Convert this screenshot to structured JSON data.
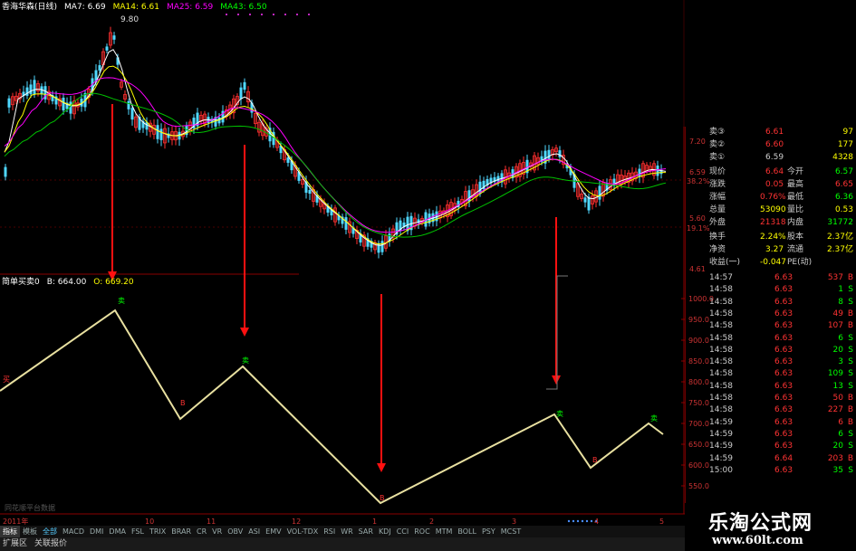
{
  "header": {
    "stock": "香海华森(日线)",
    "ma7": "MA7: 6.69",
    "ma14": "MA14: 6.61",
    "ma25": "MA25: 6.59",
    "ma43": "MA43: 6.50",
    "peak_label": "9.80",
    "colors": {
      "ma7": "#ffffff",
      "ma14": "#ffff00",
      "ma25": "#ff00ff",
      "ma43": "#00ff00"
    }
  },
  "indicator_header": {
    "name": "简单买卖0",
    "b_value": "B: 664.00",
    "o_value": "O: 669.20"
  },
  "price_axis": [
    "7.20",
    "6.59",
    "38.2%",
    "5.60",
    "19.1%",
    "4.61"
  ],
  "indicator_axis": [
    "1000.0",
    "950.0",
    "900.0",
    "850.0",
    "800.0",
    "750.0",
    "700.0",
    "650.0",
    "600.0",
    "550.0"
  ],
  "date_axis": [
    "2011年",
    "10",
    "11",
    "12",
    "1",
    "2",
    "3",
    "4",
    "5"
  ],
  "signals": {
    "buy": "B",
    "sell": "卖",
    "left_mark": "买"
  },
  "bottom_hint": "同花顺平台数据",
  "order_book": [
    {
      "label": "卖③",
      "price": "6.61",
      "vol": "97"
    },
    {
      "label": "卖②",
      "price": "6.60",
      "vol": "177"
    },
    {
      "label": "卖①",
      "price": "6.59",
      "vol": "4328"
    }
  ],
  "quote": [
    {
      "l1": "现价",
      "v1": "6.64",
      "l2": "今开",
      "v2": "6.57"
    },
    {
      "l1": "涨跌",
      "v1": "0.05",
      "l2": "最高",
      "v2": "6.65"
    },
    {
      "l1": "涨幅",
      "v1": "0.76%",
      "l2": "最低",
      "v2": "6.36"
    },
    {
      "l1": "总量",
      "v1": "53090",
      "l2": "量比",
      "v2": "0.53"
    },
    {
      "l1": "外盘",
      "v1": "21318",
      "l2": "内盘",
      "v2": "31772"
    },
    {
      "l1": "换手",
      "v1": "2.24%",
      "l2": "股本",
      "v2": "2.37亿"
    },
    {
      "l1": "净资",
      "v1": "3.27",
      "l2": "流通",
      "v2": "2.37亿"
    },
    {
      "l1": "收益(一)",
      "v1": "-0.047",
      "l2": "PE(动)",
      "v2": ""
    }
  ],
  "ticks": [
    {
      "t": "14:57",
      "p": "6.63",
      "v": "537",
      "s": "B"
    },
    {
      "t": "14:58",
      "p": "6.63",
      "v": "1",
      "s": "S"
    },
    {
      "t": "14:58",
      "p": "6.63",
      "v": "8",
      "s": "S"
    },
    {
      "t": "14:58",
      "p": "6.63",
      "v": "49",
      "s": "B"
    },
    {
      "t": "14:58",
      "p": "6.63",
      "v": "107",
      "s": "B"
    },
    {
      "t": "14:58",
      "p": "6.63",
      "v": "6",
      "s": "S"
    },
    {
      "t": "14:58",
      "p": "6.63",
      "v": "20",
      "s": "S"
    },
    {
      "t": "14:58",
      "p": "6.63",
      "v": "3",
      "s": "S"
    },
    {
      "t": "14:58",
      "p": "6.63",
      "v": "109",
      "s": "S"
    },
    {
      "t": "14:58",
      "p": "6.63",
      "v": "13",
      "s": "S"
    },
    {
      "t": "14:58",
      "p": "6.63",
      "v": "50",
      "s": "B"
    },
    {
      "t": "14:58",
      "p": "6.63",
      "v": "227",
      "s": "B"
    },
    {
      "t": "14:59",
      "p": "6.63",
      "v": "6",
      "s": "B"
    },
    {
      "t": "14:59",
      "p": "6.63",
      "v": "6",
      "s": "S"
    },
    {
      "t": "14:59",
      "p": "6.63",
      "v": "20",
      "s": "S"
    },
    {
      "t": "14:59",
      "p": "6.64",
      "v": "203",
      "s": "B"
    },
    {
      "t": "15:00",
      "p": "6.63",
      "v": "35",
      "s": "S"
    }
  ],
  "tabs": [
    "指标",
    "模板",
    "全部",
    "MACD",
    "DMI",
    "DMA",
    "FSL",
    "TRIX",
    "BRAR",
    "CR",
    "VR",
    "OBV",
    "ASI",
    "EMV",
    "VOL-TDX",
    "RSI",
    "WR",
    "SAR",
    "KDJ",
    "CCI",
    "ROC",
    "MTM",
    "BOLL",
    "PSY",
    "MCST"
  ],
  "status": [
    "扩展区",
    "关联报价"
  ],
  "logo": {
    "title": "乐淘公式网",
    "url": "www.60lt.com"
  }
}
